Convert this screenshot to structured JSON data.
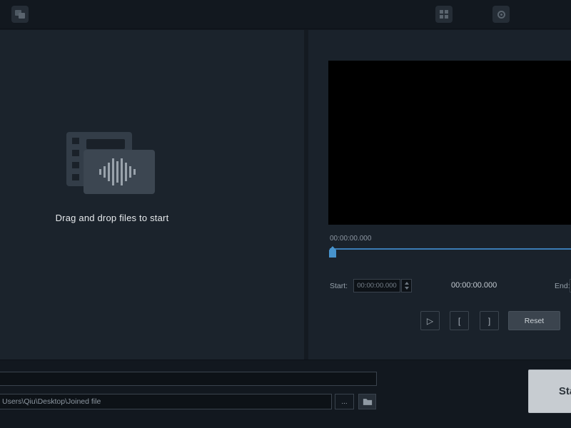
{
  "topbar": {
    "icons": {
      "logo": "app-logo-icon",
      "grid": "grid-icon",
      "settings": "settings-icon"
    }
  },
  "dropzone": {
    "message": "Drag and drop files to start"
  },
  "player": {
    "elapsed_label": "00:00:00.000",
    "current_time": "00:00:00.000",
    "start": {
      "label": "Start:",
      "value": "00:00:00.000"
    },
    "end": {
      "label": "End:",
      "value": ""
    },
    "controls": {
      "play": "▷",
      "set_start": "[",
      "set_end": "]",
      "reset": "Reset"
    }
  },
  "output": {
    "name_value": "",
    "path_value": "Users\\Qiu\\Desktop\\Joined file",
    "browse_label": "...",
    "start_button": "Start"
  },
  "colors": {
    "accent_blue": "#4793cc",
    "panel": "#1b232c",
    "chrome": "#12181f",
    "video_bg": "#000000",
    "start_button_bg": "#c7ccd1"
  }
}
